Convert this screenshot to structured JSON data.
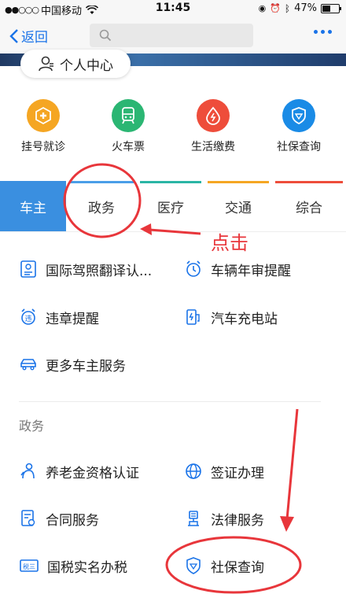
{
  "status_bar": {
    "carrier": "中国移动",
    "time": "11:45",
    "battery": "47%"
  },
  "nav": {
    "back_label": "返回",
    "search_placeholder": ""
  },
  "personal_center": "个人中心",
  "quick_actions": [
    {
      "label": "挂号就诊",
      "icon": "hospital-cross-icon",
      "color": "#f5a623"
    },
    {
      "label": "火车票",
      "icon": "train-icon",
      "color": "#2bb673"
    },
    {
      "label": "生活缴费",
      "icon": "utility-drop-icon",
      "color": "#ee4d3b"
    },
    {
      "label": "社保查询",
      "icon": "social-security-shield-icon",
      "color": "#1a8be6"
    }
  ],
  "tabs": [
    {
      "label": "车主",
      "line_color": "#3a8fe0"
    },
    {
      "label": "政务",
      "line_color": "#4a9ee8"
    },
    {
      "label": "医疗",
      "line_color": "#2ab5a5"
    },
    {
      "label": "交通",
      "line_color": "#f5a623"
    },
    {
      "label": "综合",
      "line_color": "#ee4d3b"
    }
  ],
  "car_services": [
    {
      "label": "国际驾照翻译认...",
      "icon": "license-card-icon"
    },
    {
      "label": "车辆年审提醒",
      "icon": "inspection-alarm-icon"
    },
    {
      "label": "违章提醒",
      "icon": "violation-alarm-icon"
    },
    {
      "label": "汽车充电站",
      "icon": "charging-station-icon"
    },
    {
      "label": "更多车主服务",
      "icon": "car-icon"
    }
  ],
  "gov_section_title": "政务",
  "gov_services": [
    {
      "label": "养老金资格认证",
      "icon": "pension-person-icon"
    },
    {
      "label": "签证办理",
      "icon": "globe-icon"
    },
    {
      "label": "合同服务",
      "icon": "contract-doc-icon"
    },
    {
      "label": "法律服务",
      "icon": "law-court-icon"
    },
    {
      "label": "国税实名办税",
      "icon": "tax-card-icon"
    },
    {
      "label": "社保查询",
      "icon": "social-security-shield-icon"
    }
  ],
  "annotation": {
    "text": "点击",
    "color": "#e8363b"
  }
}
